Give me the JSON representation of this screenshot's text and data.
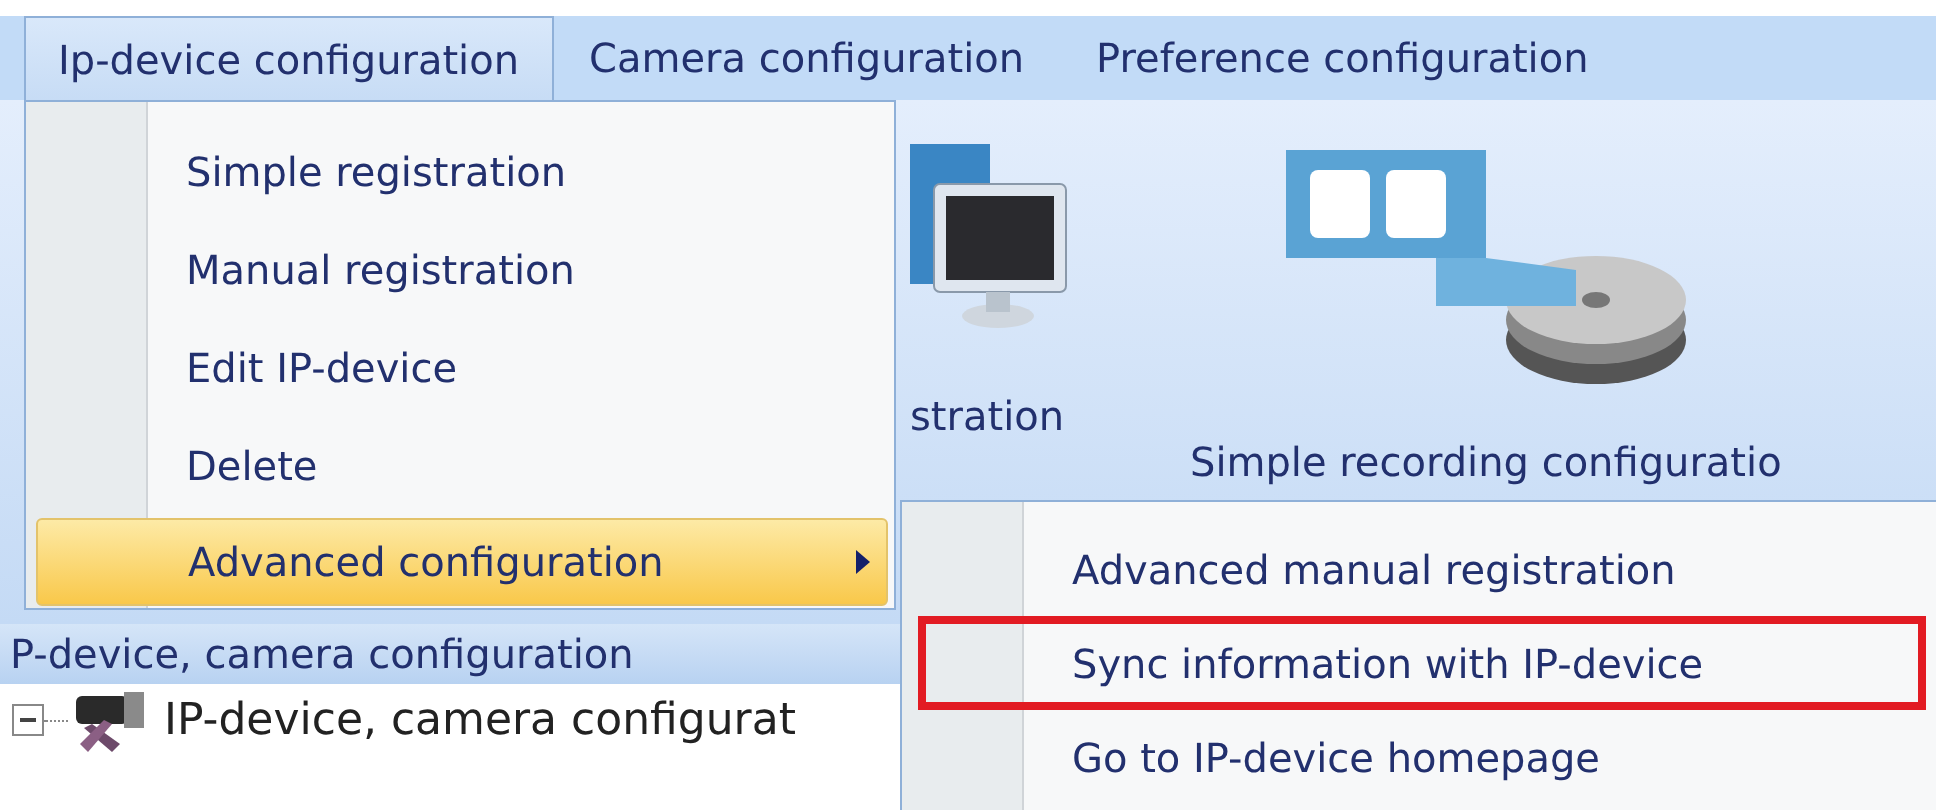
{
  "menu_bar": [
    {
      "label": "Ip-device configuration",
      "selected": true
    },
    {
      "label": "Camera configuration",
      "selected": false
    },
    {
      "label": "Preference configuration",
      "selected": false
    }
  ],
  "ribbon": [
    {
      "label": "stration",
      "kind": "monitor"
    },
    {
      "label": "Simple recording configuratio",
      "kind": "film"
    }
  ],
  "panel": {
    "title": "P-device, camera configuration",
    "tree": [
      {
        "label": "IP-device, camera configurat",
        "expanded": true
      }
    ]
  },
  "dropdown": {
    "items": [
      {
        "label": "Simple registration",
        "selected": false,
        "has_submenu": false
      },
      {
        "label": "Manual registration",
        "selected": false,
        "has_submenu": false
      },
      {
        "label": "Edit IP-device",
        "selected": false,
        "has_submenu": false
      },
      {
        "label": "Delete",
        "selected": false,
        "has_submenu": false
      },
      {
        "label": "Advanced configuration",
        "selected": true,
        "has_submenu": true
      }
    ]
  },
  "submenu": {
    "items": [
      {
        "label": "Advanced manual registration",
        "annotated": false
      },
      {
        "label": "Sync information with IP-device",
        "annotated": true
      },
      {
        "label": "Go to IP-device homepage",
        "annotated": false
      }
    ]
  }
}
